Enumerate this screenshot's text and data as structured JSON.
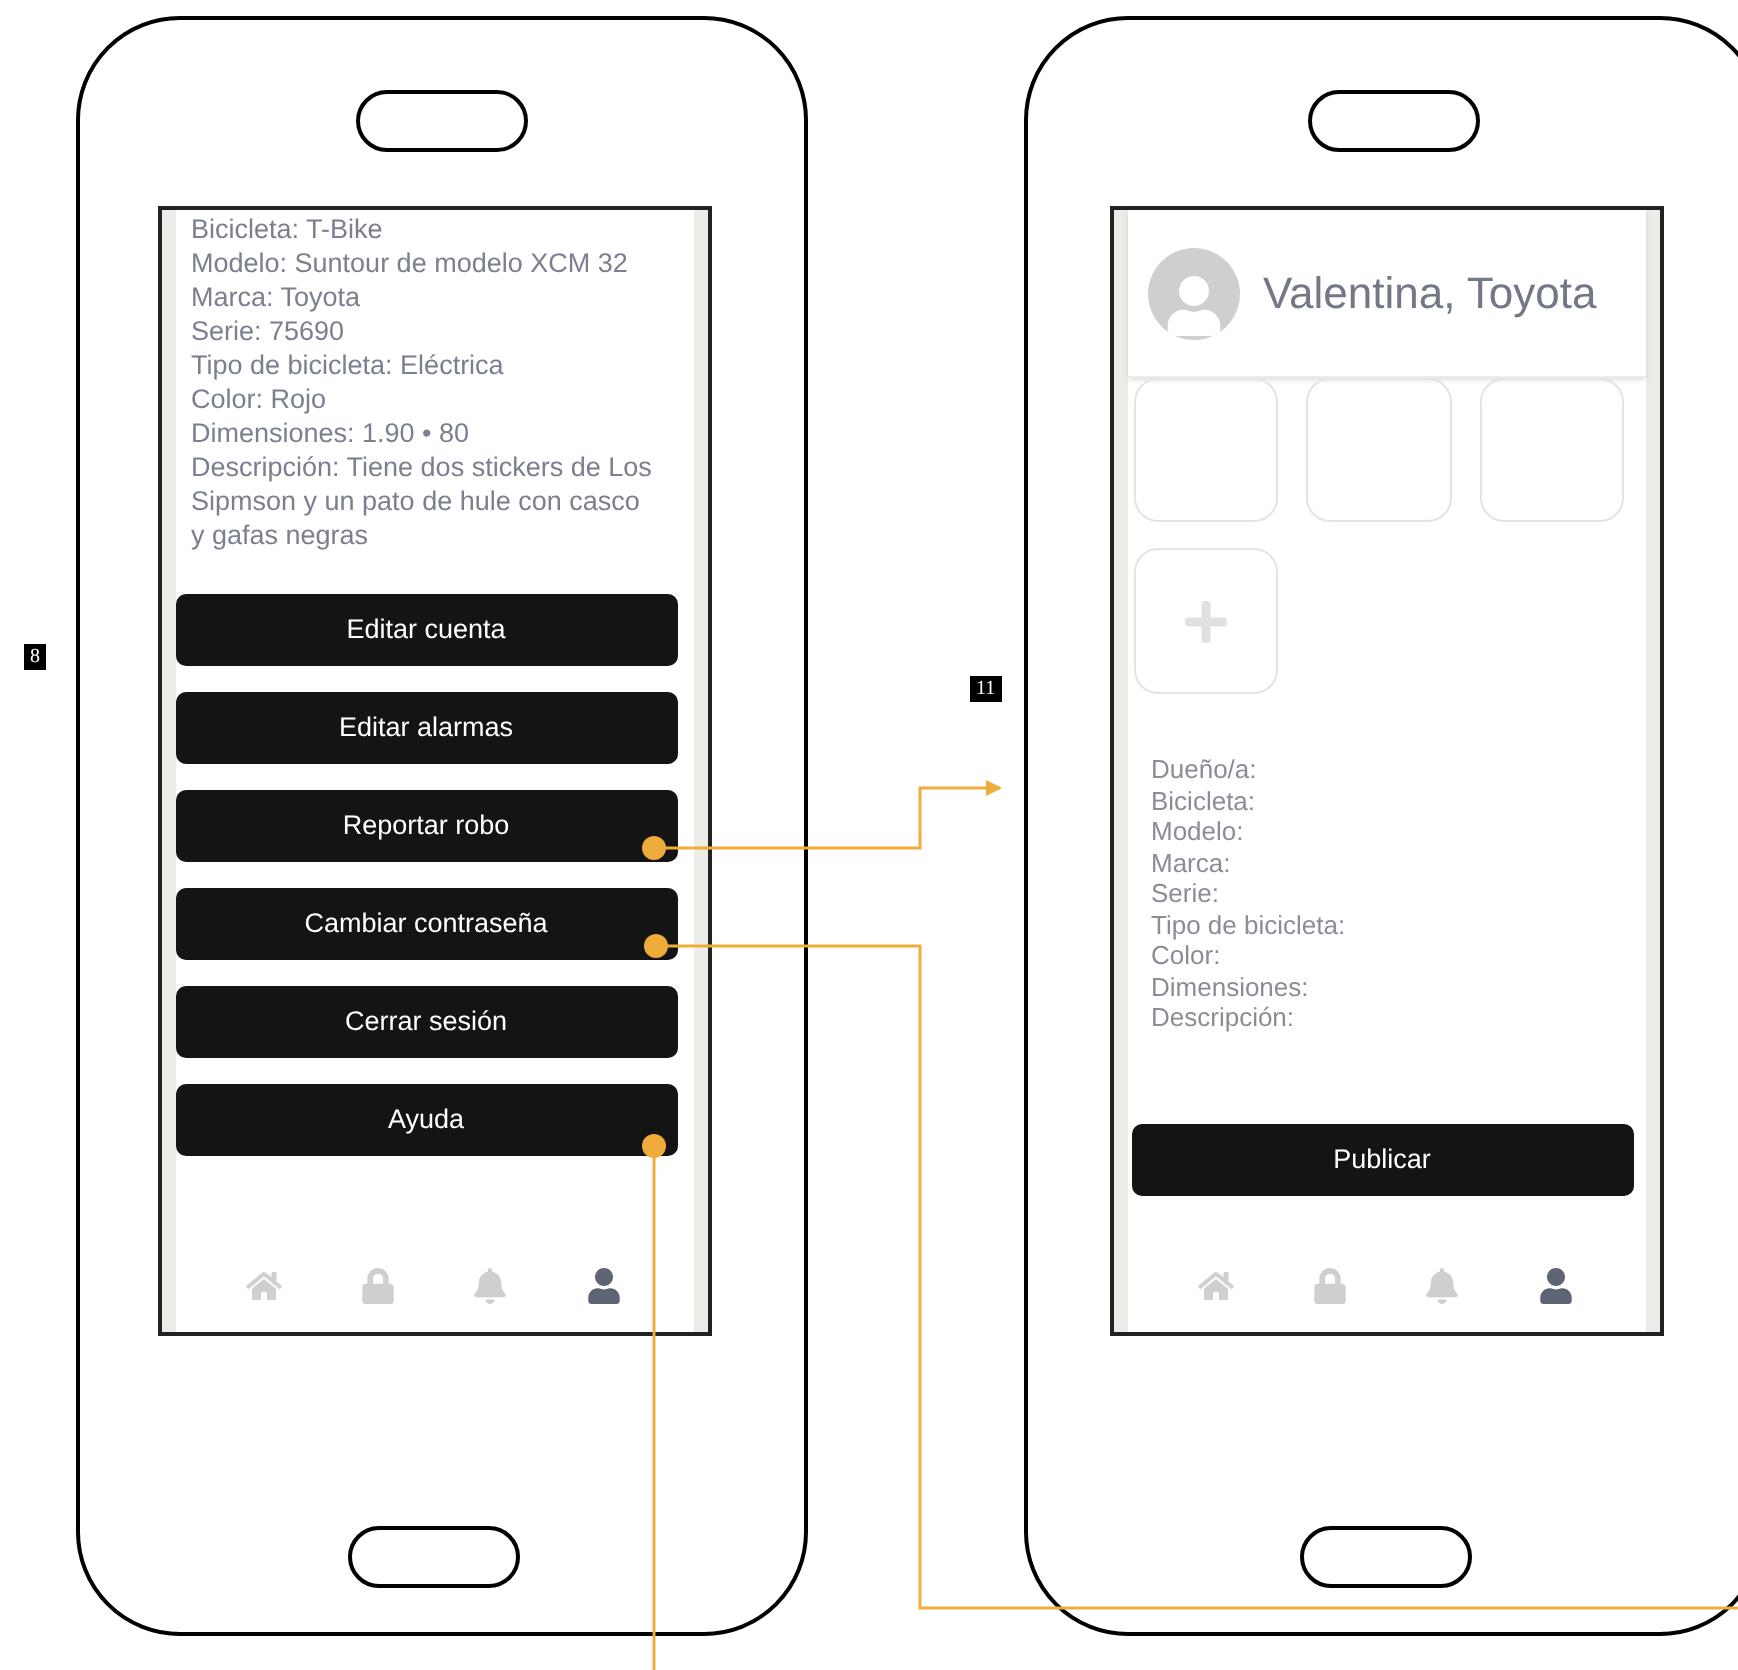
{
  "screens": [
    {
      "badge": "8",
      "details": [
        "Bicicleta: T-Bike",
        "Modelo: Suntour de modelo XCM 32",
        "Marca: Toyota",
        "Serie: 75690",
        "Tipo de bicicleta: Eléctrica",
        "Color: Rojo",
        "Dimensiones: 1.90 • 80",
        "Descripción: Tiene dos stickers de Los Sipmson y un pato de hule con casco y gafas negras"
      ],
      "buttons": [
        "Editar cuenta",
        "Editar alarmas",
        "Reportar robo",
        "Cambiar contraseña",
        "Cerrar sesión",
        "Ayuda"
      ],
      "nav": [
        {
          "kind": "home",
          "selected": false
        },
        {
          "kind": "lock",
          "selected": false
        },
        {
          "kind": "bell",
          "selected": false
        },
        {
          "kind": "user",
          "selected": true
        }
      ]
    },
    {
      "badge": "11",
      "header": {
        "name": "Valentina, Toyota"
      },
      "photos": [
        {
          "kind": "empty"
        },
        {
          "kind": "empty"
        },
        {
          "kind": "empty"
        },
        {
          "kind": "add"
        }
      ],
      "fields": [
        "Dueño/a:",
        "Bicicleta:",
        "Modelo:",
        "Marca:",
        "Serie:",
        "Tipo de bicicleta:",
        "Color:",
        "Dimensiones:",
        "Descripción:"
      ],
      "buttons": [
        "Publicar"
      ],
      "nav": [
        {
          "kind": "home",
          "selected": false
        },
        {
          "kind": "lock",
          "selected": false
        },
        {
          "kind": "bell",
          "selected": false
        },
        {
          "kind": "user",
          "selected": true
        }
      ]
    }
  ]
}
